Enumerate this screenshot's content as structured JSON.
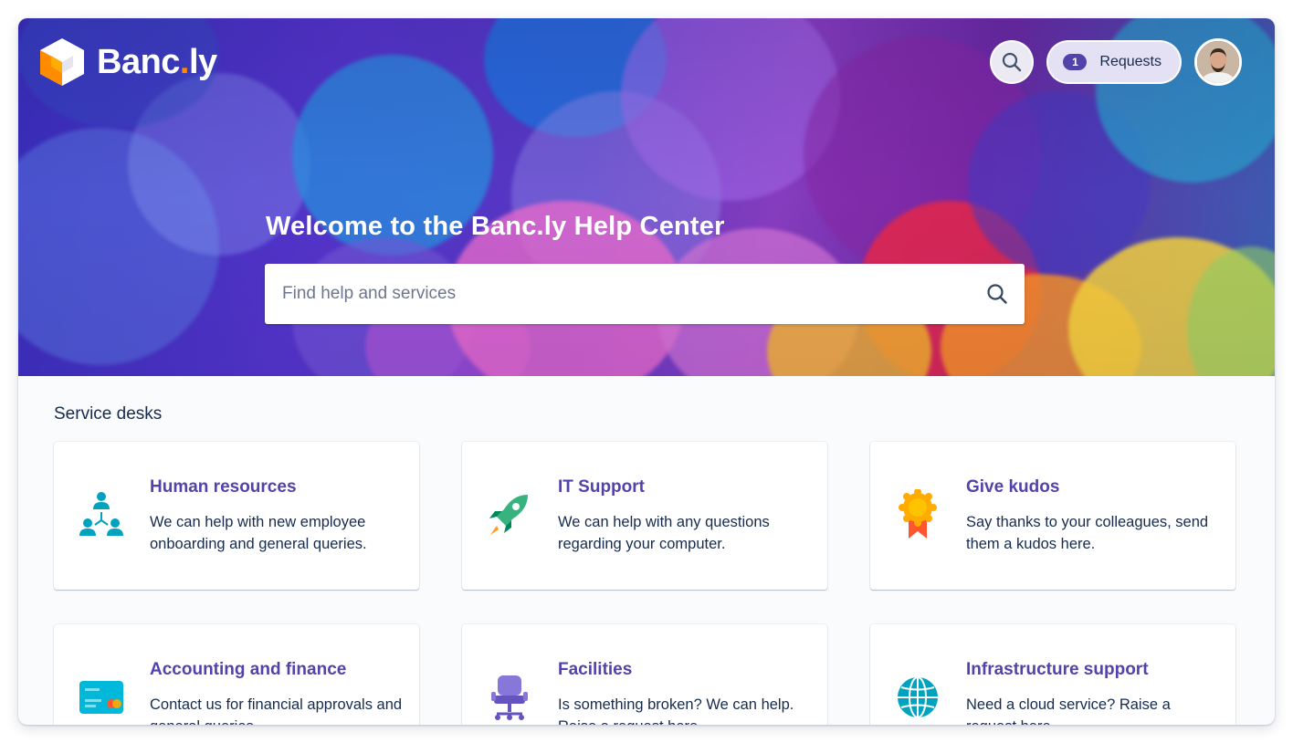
{
  "brand": {
    "name_main": "Banc",
    "name_dot": ".",
    "name_tail": "ly"
  },
  "header": {
    "requests_label": "Requests",
    "requests_count": "1"
  },
  "hero": {
    "welcome": "Welcome to the Banc.ly Help Center",
    "search_placeholder": "Find help and services"
  },
  "service_desks": {
    "title": "Service desks",
    "cards": [
      {
        "title": "Human resources",
        "desc": "We can help with new employee onboarding and general queries.",
        "icon": "people-icon"
      },
      {
        "title": "IT Support",
        "desc": "We can help with any questions regarding your computer.",
        "icon": "rocket-icon"
      },
      {
        "title": "Give kudos",
        "desc": "Say thanks to your colleagues, send them a kudos here.",
        "icon": "award-ribbon-icon"
      },
      {
        "title": "Accounting and finance",
        "desc": "Contact us for financial approvals and general queries.",
        "icon": "credit-card-icon"
      },
      {
        "title": "Facilities",
        "desc": "Is something broken? We can help. Raise a request here.",
        "icon": "office-chair-icon"
      },
      {
        "title": "Infrastructure support",
        "desc": "Need a cloud service? Raise a request here.",
        "icon": "globe-icon"
      }
    ]
  },
  "colors": {
    "accent": "#5243aa",
    "logo_orange": "#ff8b00",
    "text": "#172b4d"
  }
}
